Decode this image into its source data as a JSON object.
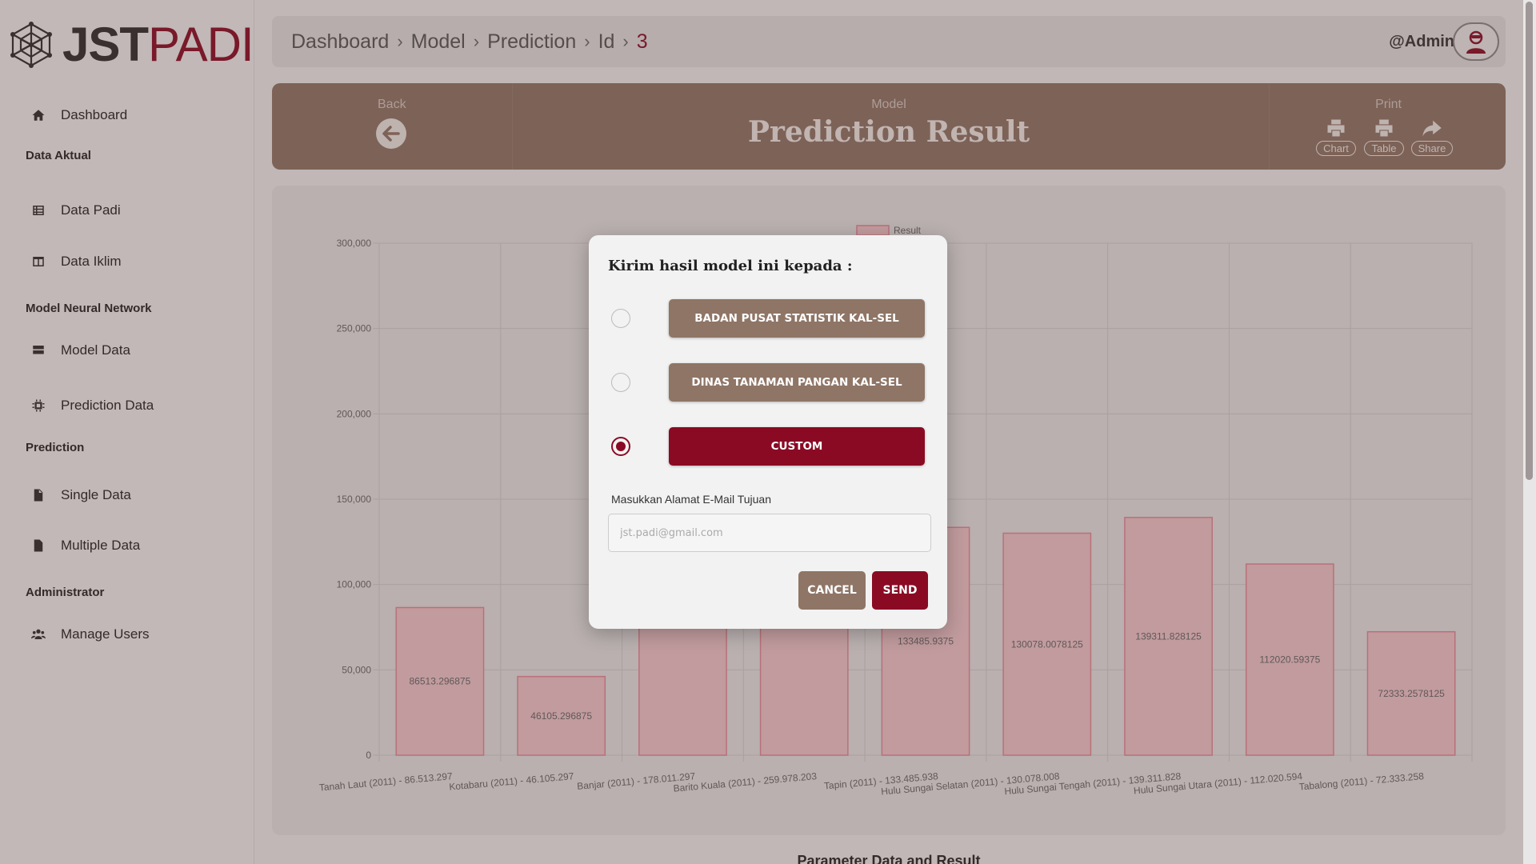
{
  "brand": {
    "jst": "JST",
    "padi": "PADI"
  },
  "sidebar": {
    "items": [
      {
        "type": "item",
        "label": "Dashboard",
        "icon": "home-icon"
      },
      {
        "type": "section",
        "label": "Data Aktual"
      },
      {
        "type": "item",
        "label": "Data Padi",
        "icon": "table-list-icon"
      },
      {
        "type": "item",
        "label": "Data Iklim",
        "icon": "table-columns-icon"
      },
      {
        "type": "section",
        "label": "Model Neural Network"
      },
      {
        "type": "item",
        "label": "Model Data",
        "icon": "database-icon"
      },
      {
        "type": "item",
        "label": "Prediction Data",
        "icon": "cpu-chip-icon"
      },
      {
        "type": "section",
        "label": "Prediction"
      },
      {
        "type": "item",
        "label": "Single Data",
        "icon": "file-icon"
      },
      {
        "type": "item",
        "label": "Multiple Data",
        "icon": "file-csv-icon"
      },
      {
        "type": "section",
        "label": "Administrator"
      },
      {
        "type": "item",
        "label": "Manage Users",
        "icon": "users-icon"
      }
    ]
  },
  "breadcrumb": {
    "items": [
      "Dashboard",
      "Model",
      "Prediction",
      "Id"
    ],
    "current": "3"
  },
  "user": {
    "name": "@Admin",
    "icon": "user-avatar-icon"
  },
  "header": {
    "back_label": "Back",
    "model_label": "Model",
    "title": "Prediction Result",
    "print_label": "Print",
    "tools": [
      {
        "label": "Chart",
        "icon": "printer-icon"
      },
      {
        "label": "Table",
        "icon": "printer-icon"
      },
      {
        "label": "Share",
        "icon": "share-icon"
      }
    ]
  },
  "chart_data": {
    "type": "bar",
    "legend": [
      "Result"
    ],
    "legend_position": "top-center",
    "grid": true,
    "ylim": [
      0,
      300000
    ],
    "yticks": [
      "0",
      "50,000",
      "100,000",
      "150,000",
      "200,000",
      "250,000",
      "300,000"
    ],
    "categories": [
      "Tanah Laut (2011) - 86.513.297",
      "Kotabaru (2011) - 46.105.297",
      "Banjar (2011) - 178.011.297",
      "Barito Kuala (2011) - 259.978.203",
      "Tapin (2011) - 133.485.938",
      "Hulu Sungai Selatan (2011) - 130.078.008",
      "Hulu Sungai Tengah (2011) - 139.311.828",
      "Hulu Sungai Utara (2011) - 112.020.594",
      "Tabalong (2011) - 72.333.258"
    ],
    "series": [
      {
        "name": "Result",
        "values": [
          86513.296875,
          46105.296875,
          178011.296875,
          259978.203125,
          133485.9375,
          130078.0078125,
          139311.828125,
          112020.59375,
          72333.2578125
        ],
        "labels": [
          "86513.296875",
          "46105.296875",
          "",
          "",
          "133485.9375",
          "130078.0078125",
          "139311.828125",
          "112020.59375",
          "72333.2578125"
        ]
      }
    ],
    "color_fill": "#f4c9cf",
    "color_stroke": "#e88a98"
  },
  "bottom_title": "Parameter Data and Result",
  "modal": {
    "title": "Kirim hasil model ini kepada :",
    "options": [
      {
        "label": "BADAN PUSAT STATISTIK KAL-SEL",
        "selected": false
      },
      {
        "label": "DINAS TANAMAN PANGAN KAL-SEL",
        "selected": false
      },
      {
        "label": "CUSTOM",
        "selected": true
      }
    ],
    "email_label": "Masukkan Alamat E-Mail Tujuan",
    "email_value": "",
    "email_placeholder": "jst.padi@gmail.com",
    "cancel_label": "CANCEL",
    "send_label": "SEND"
  },
  "colors": {
    "brand_red": "#8a0a24",
    "brown": "#8f7566"
  }
}
